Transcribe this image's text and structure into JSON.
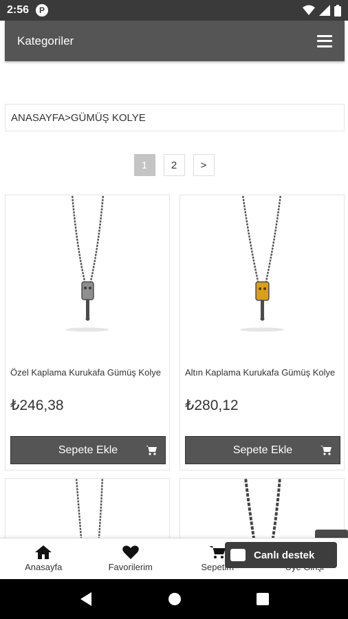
{
  "status_bar": {
    "time": "2:56",
    "app_icon": "P"
  },
  "app_bar": {
    "title": "Kategoriler",
    "menu_icon": "hamburger-icon"
  },
  "breadcrumb": {
    "text": "ANASAYFA>GÜMÜŞ KOLYE"
  },
  "pagination": {
    "pages": [
      "1",
      "2"
    ],
    "current": "1",
    "next": ">"
  },
  "products": [
    {
      "name": "Özel Kaplama Kurukafa Gümüş Kolye",
      "price": "₺246,38",
      "button": "Sepete Ekle",
      "pendant_color": "#8f8f8f"
    },
    {
      "name": "Altın Kaplama Kurukafa Gümüş Kolye",
      "price": "₺280,12",
      "button": "Sepete Ekle",
      "pendant_color": "#d9a020"
    }
  ],
  "bottom_nav": [
    {
      "label": "Anasayfa",
      "icon": "home-icon"
    },
    {
      "label": "Favorilerim",
      "icon": "heart-icon"
    },
    {
      "label": "Sepetim",
      "icon": "cart-icon"
    },
    {
      "label": "Üye Girişi",
      "icon": "user-icon"
    }
  ],
  "chat": {
    "label": "Canlı destek"
  },
  "colors": {
    "toolbar": "#555555",
    "status_bar": "#3a3a3a",
    "active_page": "#c4c4c4"
  }
}
